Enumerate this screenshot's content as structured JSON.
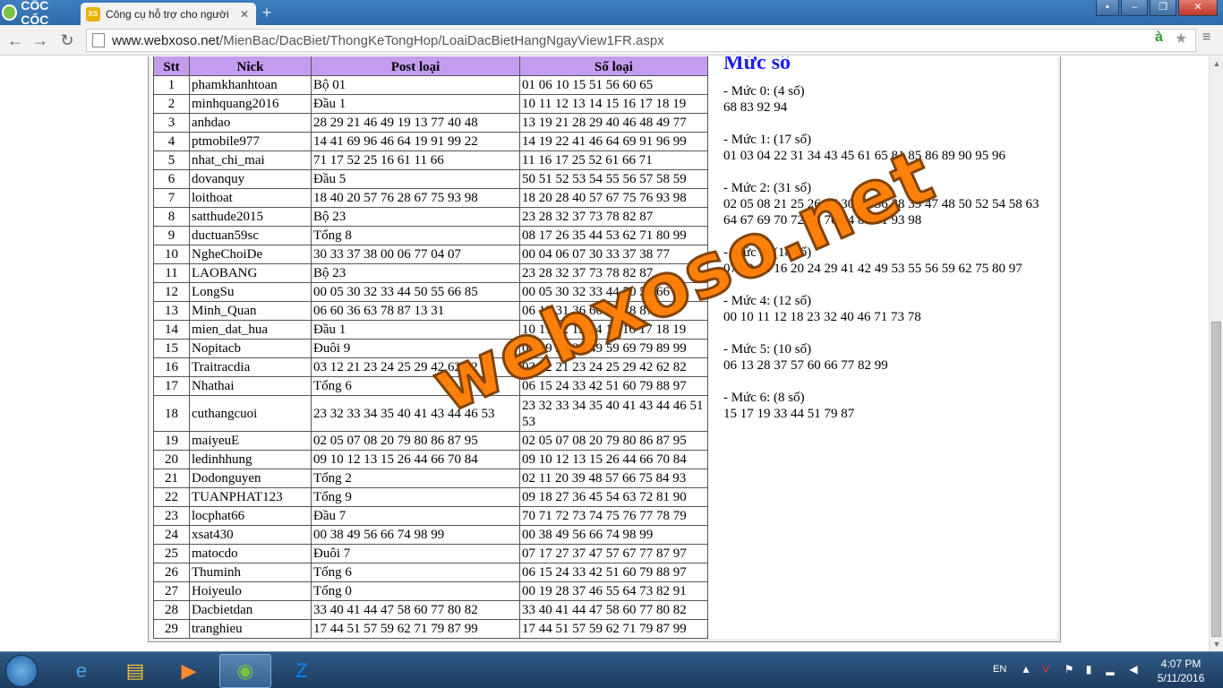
{
  "browser": {
    "logo": "CỐC CỐC",
    "tab_title": "Công cụ hỗ trợ cho người",
    "tab_favicon": "XS",
    "url_host": "www.webxoso.net",
    "url_path": "/MienBac/DacBiet/ThongKeTongHop/LoaiDacBietHangNgayView1FR.aspx"
  },
  "table": {
    "headers": [
      "Stt",
      "Nick",
      "Post loại",
      "Số loại"
    ],
    "rows": [
      [
        "1",
        "phamkhanhtoan",
        "Bộ 01",
        "01 06 10 15 51 56 60 65"
      ],
      [
        "2",
        "minhquang2016",
        "Đầu 1",
        "10 11 12 13 14 15 16 17 18 19"
      ],
      [
        "3",
        "anhdao",
        "28 29 21 46 49 19 13 77 40 48",
        "13 19 21 28 29 40 46 48 49 77"
      ],
      [
        "4",
        "ptmobile977",
        "14 41 69 96 46 64 19 91 99 22",
        "14 19 22 41 46 64 69 91 96 99"
      ],
      [
        "5",
        "nhat_chi_mai",
        "71 17 52 25 16 61 11 66",
        "11 16 17 25 52 61 66 71"
      ],
      [
        "6",
        "dovanquy",
        "Đầu 5",
        "50 51 52 53 54 55 56 57 58 59"
      ],
      [
        "7",
        "loithoat",
        "18 40 20 57 76 28 67 75 93 98",
        "18 20 28 40 57 67 75 76 93 98"
      ],
      [
        "8",
        "satthude2015",
        "Bộ 23",
        "23 28 32 37 73 78 82 87"
      ],
      [
        "9",
        "ductuan59sc",
        "Tổng 8",
        "08 17 26 35 44 53 62 71 80 99"
      ],
      [
        "10",
        "NgheChoiDe",
        "30 33 37 38 00 06 77 04 07",
        "00 04 06 07 30 33 37 38 77"
      ],
      [
        "11",
        "LAOBANG",
        "Bộ 23",
        "23 28 32 37 73 78 82 87"
      ],
      [
        "12",
        "LongSu",
        "00 05 30 32 33 44 50 55 66 85",
        "00 05 30 32 33 44 50 55 66 85"
      ],
      [
        "13",
        "Minh_Quan",
        "06 60 36 63 78 87 13 31",
        "06 13 31 36 60 63 78 87"
      ],
      [
        "14",
        "mien_dat_hua",
        "Đầu 1",
        "10 11 12 13 14 15 16 17 18 19"
      ],
      [
        "15",
        "Nopitacb",
        "Đuôi 9",
        "09 19 29 39 49 59 69 79 89 99"
      ],
      [
        "16",
        "Traitracdia",
        "03 12 21 23 24 25 29 42 62 82",
        "03 12 21 23 24 25 29 42 62 82"
      ],
      [
        "17",
        "Nhathai",
        "Tổng 6",
        "06 15 24 33 42 51 60 79 88 97"
      ],
      [
        "18",
        "cuthangcuoi",
        "23 32 33 34 35 40 41 43 44 46 53",
        "23 32 33 34 35 40 41 43 44 46 51 53"
      ],
      [
        "19",
        "maiyeuE",
        "02 05 07 08 20 79 80 86 87 95",
        "02 05 07 08 20 79 80 86 87 95"
      ],
      [
        "20",
        "ledinhhung",
        "09 10 12 13 15 26 44 66 70 84",
        "09 10 12 13 15 26 44 66 70 84"
      ],
      [
        "21",
        "Dodonguyen",
        "Tổng 2",
        "02 11 20 39 48 57 66 75 84 93"
      ],
      [
        "22",
        "TUANPHAT123",
        "Tổng 9",
        "09 18 27 36 45 54 63 72 81 90"
      ],
      [
        "23",
        "locphat66",
        "Đầu 7",
        "70 71 72 73 74 75 76 77 78 79"
      ],
      [
        "24",
        "xsat430",
        "00 38 49 56 66 74 98 99",
        "00 38 49 56 66 74 98 99"
      ],
      [
        "25",
        "matocdo",
        "Đuôi 7",
        "07 17 27 37 47 57 67 77 87 97"
      ],
      [
        "26",
        "Thuminh",
        "Tổng 6",
        "06 15 24 33 42 51 60 79 88 97"
      ],
      [
        "27",
        "Hoiyeulo",
        "Tổng 0",
        "00 19 28 37 46 55 64 73 82 91"
      ],
      [
        "28",
        "Dacbietdan",
        "33 40 41 44 47 58 60 77 80 82",
        "33 40 41 44 47 58 60 77 80 82"
      ],
      [
        "29",
        "tranghieu",
        "17 44 51 57 59 62 71 79 87 99",
        "17 44 51 57 59 62 71 79 87 99"
      ]
    ]
  },
  "muc": {
    "title": "Mức số",
    "groups": [
      {
        "label": "- Mức 0: (4 số)",
        "numbers": "68 83 92 94"
      },
      {
        "label": "- Mức 1: (17 số)",
        "numbers": "01 03 04 22 31 34 43 45 61 65 81 85 86 89 90 95 96"
      },
      {
        "label": "- Mức 2: (31 số)",
        "numbers": "02 05 08 21 25 26 27 30 35 36 38 39 47 48 50 52 54 58 63 64 67 69 70 72 74 76 84 88 91 93 98"
      },
      {
        "label": "- Mức 3: (18 số)",
        "numbers": "07 09 14 16 20 24 29 41 42 49 53 55 56 59 62 75 80 97"
      },
      {
        "label": "- Mức 4: (12 số)",
        "numbers": "00 10 11 12 18 23 32 40 46 71 73 78"
      },
      {
        "label": "- Mức 5: (10 số)",
        "numbers": "06 13 28 37 57 60 66 77 82 99"
      },
      {
        "label": "- Mức 6: (8 số)",
        "numbers": "15 17 19 33 44 51 79 87"
      }
    ]
  },
  "watermark": "webxoso.net",
  "taskbar": {
    "lang": "EN",
    "time": "4:07 PM",
    "date": "5/11/2016"
  },
  "colors": {
    "header_bg": "#c39cf0",
    "muc_title": "#1d1df0",
    "watermark": "#ff7b00"
  }
}
